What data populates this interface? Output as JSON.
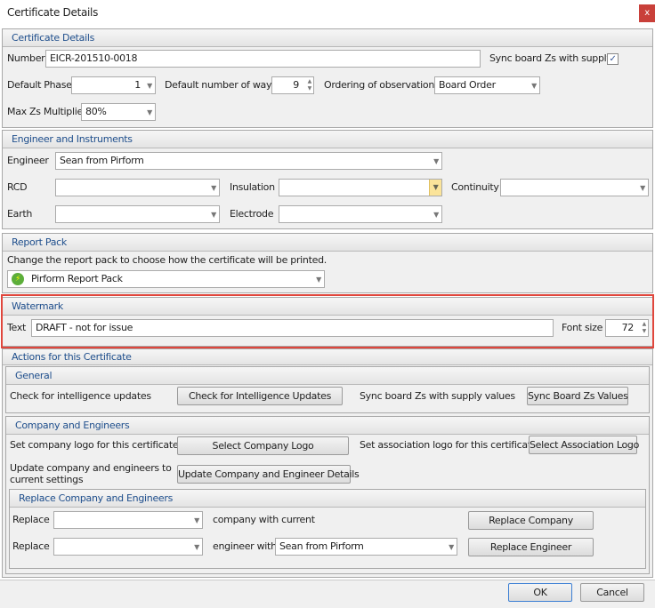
{
  "window": {
    "title": "Certificate Details",
    "close": "x"
  },
  "cert": {
    "header": "Certificate Details",
    "number_label": "Number",
    "number": "EICR-201510-0018",
    "sync_label": "Sync board Zs with supply",
    "sync_checked": true,
    "phase_label": "Default Phase",
    "phase": "1",
    "ways_label": "Default number of ways",
    "ways": "9",
    "ordering_label": "Ordering of observations",
    "ordering": "Board Order",
    "maxzs_label": "Max Zs Multiplier",
    "maxzs": "80%"
  },
  "engineer": {
    "header": "Engineer and Instruments",
    "engineer_label": "Engineer",
    "engineer": "Sean from Pirform",
    "rcd_label": "RCD",
    "rcd": "",
    "insulation_label": "Insulation",
    "insulation": "",
    "continuity_label": "Continuity",
    "continuity": "",
    "earth_label": "Earth",
    "earth": "",
    "electrode_label": "Electrode",
    "electrode": ""
  },
  "report": {
    "header": "Report Pack",
    "description": "Change the report pack to choose how the certificate will be printed.",
    "pack": "Pirform Report Pack"
  },
  "watermark": {
    "header": "Watermark",
    "text_label": "Text",
    "text": "DRAFT - not for issue",
    "fontsize_label": "Font size",
    "fontsize": "72",
    "highlight_color": "#e0463c"
  },
  "actions": {
    "header": "Actions for this Certificate",
    "general": {
      "header": "General",
      "check_label": "Check for intelligence updates",
      "check_button": "Check for Intelligence Updates",
      "sync_label": "Sync board Zs with supply values",
      "sync_button": "Sync Board Zs Values"
    },
    "company": {
      "header": "Company and Engineers",
      "logo_label": "Set company logo for this certificate",
      "logo_button": "Select Company Logo",
      "assoc_label": "Set association logo for this certificate",
      "assoc_button": "Select Association Logo",
      "update_label_1": "Update company and engineers to",
      "update_label_2": "current settings",
      "update_button": "Update Company and Engineer Details"
    },
    "replace": {
      "header": "Replace Company and Engineers",
      "replace_label": "Replace",
      "company_value": "",
      "company_with": "company with current",
      "company_button": "Replace Company",
      "replace_label2": "Replace",
      "engineer_value": "",
      "engineer_with": "engineer with",
      "engineer_current": "Sean from Pirform",
      "engineer_button": "Replace Engineer"
    }
  },
  "footer": {
    "ok": "OK",
    "cancel": "Cancel"
  }
}
